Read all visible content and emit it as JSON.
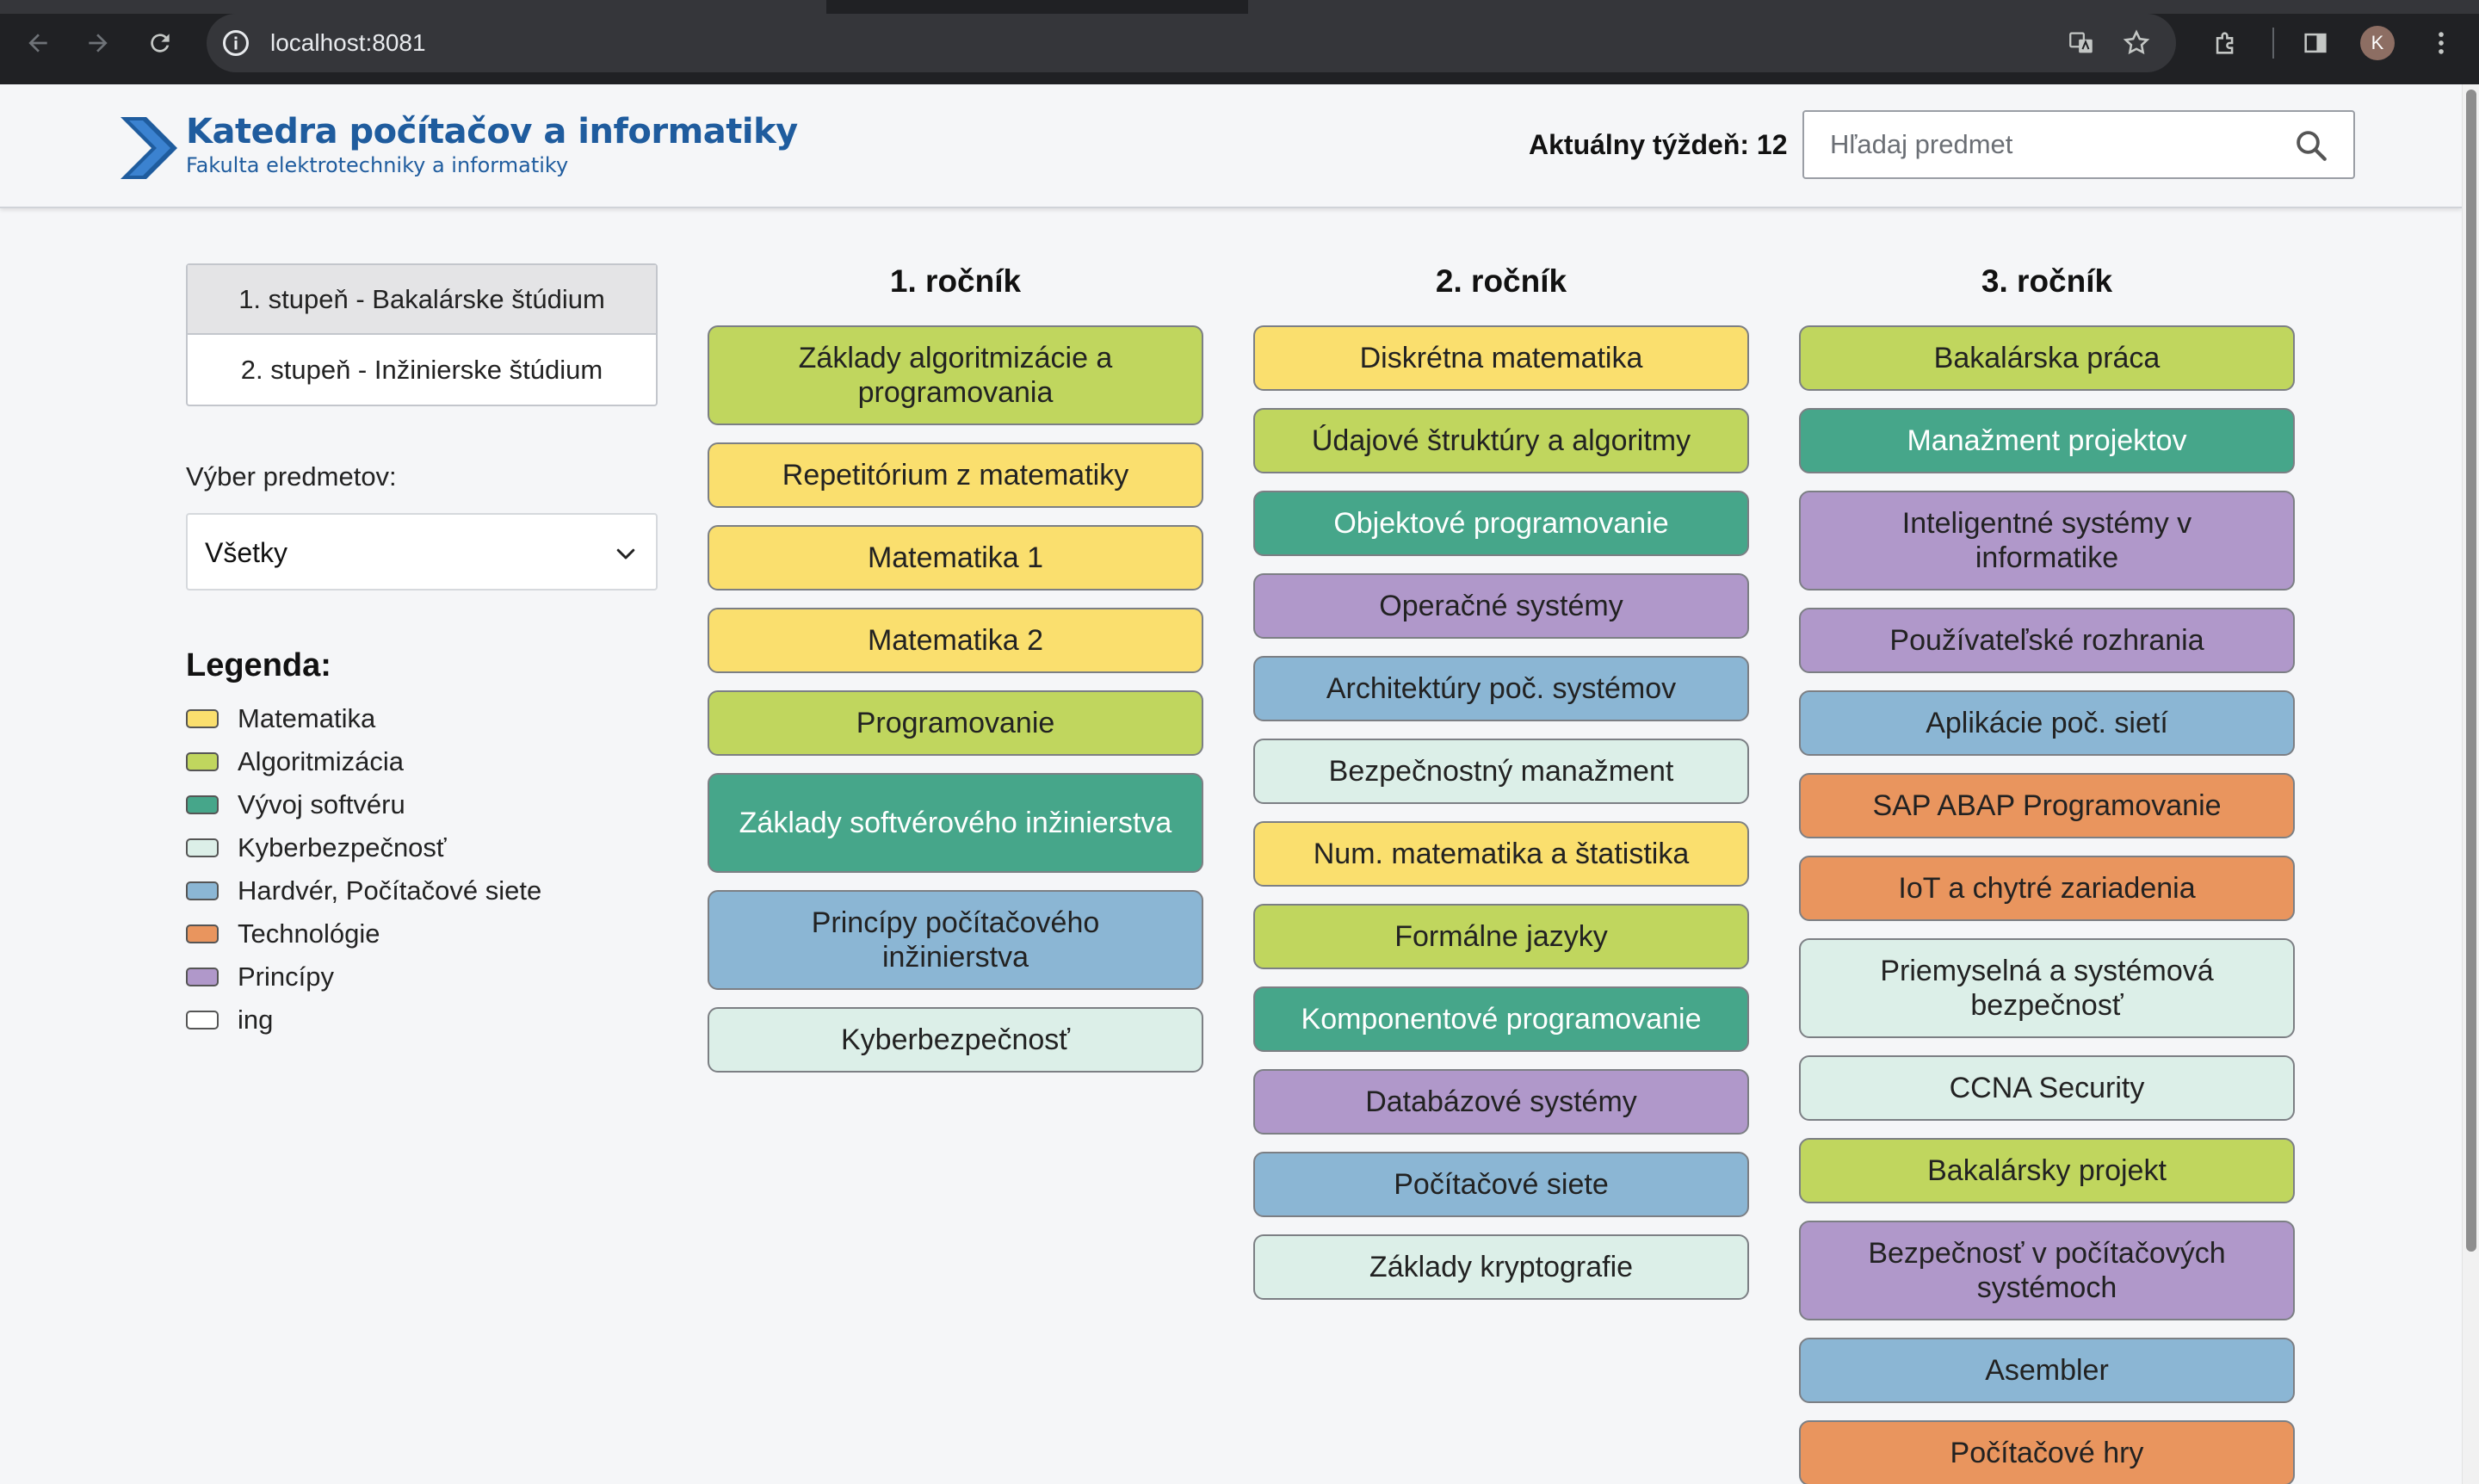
{
  "browser": {
    "url": "localhost:8081",
    "profile_initial": "K"
  },
  "header": {
    "logo_title": "Katedra počítačov a informatiky",
    "logo_subtitle": "Fakulta elektrotechniky a informatiky",
    "week_label": "Aktuálny týždeň: 12",
    "search_placeholder": "Hľadaj predmet"
  },
  "sidebar": {
    "levels": [
      {
        "label": "1. stupeň - Bakalárske štúdium",
        "active": true
      },
      {
        "label": "2. stupeň - Inžinierske štúdium",
        "active": false
      }
    ],
    "filter_label": "Výber predmetov:",
    "filter_value": "Všetky",
    "legend_title": "Legenda:",
    "legend": [
      {
        "label": "Matematika",
        "color": "#fadf6e"
      },
      {
        "label": "Algoritmizácia",
        "color": "#c0d65e"
      },
      {
        "label": "Vývoj softvéru",
        "color": "#46a68a"
      },
      {
        "label": "Kyberbezpečnosť",
        "color": "#dcefe8"
      },
      {
        "label": "Hardvér, Počítačové siete",
        "color": "#8bb6d4"
      },
      {
        "label": "Technológie",
        "color": "#e9955e"
      },
      {
        "label": "Princípy",
        "color": "#b098ca"
      },
      {
        "label": "ing",
        "color": "#ffffff"
      }
    ]
  },
  "columns": [
    {
      "title": "1. ročník",
      "courses": [
        {
          "name": "Základy algoritmizácie a programovania",
          "category": "algo",
          "lines": 2
        },
        {
          "name": "Repetitórium z matematiky",
          "category": "math",
          "lines": 1
        },
        {
          "name": "Matematika 1",
          "category": "math",
          "lines": 1
        },
        {
          "name": "Matematika 2",
          "category": "math",
          "lines": 1
        },
        {
          "name": "Programovanie",
          "category": "algo",
          "lines": 1
        },
        {
          "name": "Základy softvérového inžinierstva",
          "category": "sw",
          "lines": 2
        },
        {
          "name": "Princípy počítačového inžinierstva",
          "category": "hw",
          "lines": 2
        },
        {
          "name": "Kyberbezpečnosť",
          "category": "cyber",
          "lines": 1
        }
      ]
    },
    {
      "title": "2. ročník",
      "courses": [
        {
          "name": "Diskrétna matematika",
          "category": "math",
          "lines": 1
        },
        {
          "name": "Údajové štruktúry a algoritmy",
          "category": "algo",
          "lines": 1
        },
        {
          "name": "Objektové programovanie",
          "category": "sw",
          "lines": 1
        },
        {
          "name": "Operačné systémy",
          "category": "princ",
          "lines": 1
        },
        {
          "name": "Architektúry poč. systémov",
          "category": "hw",
          "lines": 1
        },
        {
          "name": "Bezpečnostný manažment",
          "category": "cyber",
          "lines": 1
        },
        {
          "name": "Num. matematika a štatistika",
          "category": "math",
          "lines": 1
        },
        {
          "name": "Formálne jazyky",
          "category": "algo",
          "lines": 1
        },
        {
          "name": "Komponentové programovanie",
          "category": "sw",
          "lines": 1
        },
        {
          "name": "Databázové systémy",
          "category": "princ",
          "lines": 1
        },
        {
          "name": "Počítačové siete",
          "category": "hw",
          "lines": 1
        },
        {
          "name": "Základy kryptografie",
          "category": "cyber",
          "lines": 1
        }
      ]
    },
    {
      "title": "3. ročník",
      "courses": [
        {
          "name": "Bakalárska práca",
          "category": "algo",
          "lines": 1
        },
        {
          "name": "Manažment projektov",
          "category": "sw",
          "lines": 1
        },
        {
          "name": "Inteligentné systémy v informatike",
          "category": "princ",
          "lines": 2
        },
        {
          "name": "Používateľské rozhrania",
          "category": "princ",
          "lines": 1
        },
        {
          "name": "Aplikácie poč. sietí",
          "category": "hw",
          "lines": 1
        },
        {
          "name": "SAP ABAP Programovanie",
          "category": "tech",
          "lines": 1
        },
        {
          "name": "IoT a chytré zariadenia",
          "category": "tech",
          "lines": 1
        },
        {
          "name": "Priemyselná a systémová bezpečnosť",
          "category": "cyber",
          "lines": 2
        },
        {
          "name": "CCNA Security",
          "category": "cyber",
          "lines": 1
        },
        {
          "name": "Bakalársky projekt",
          "category": "algo",
          "lines": 1
        },
        {
          "name": "Bezpečnosť v počítačových systémoch",
          "category": "princ",
          "lines": 2
        },
        {
          "name": "Asembler",
          "category": "hw",
          "lines": 1
        },
        {
          "name": "Počítačové hry",
          "category": "tech",
          "lines": 1
        }
      ]
    }
  ]
}
